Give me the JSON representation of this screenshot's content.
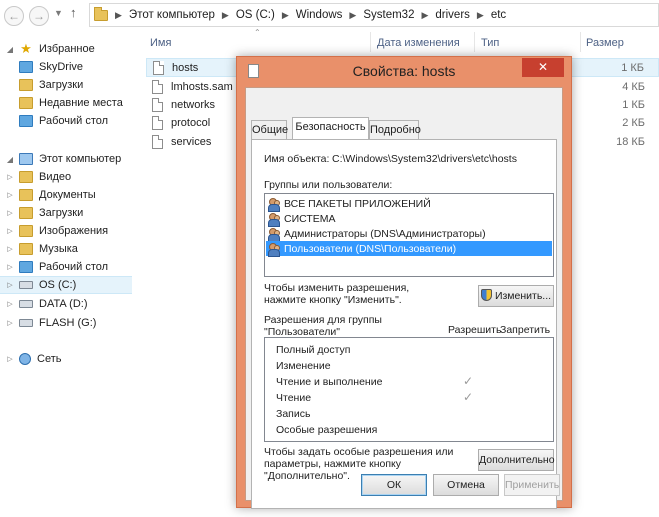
{
  "address": {
    "crumbs": [
      "Этот компьютер",
      "OS (C:)",
      "Windows",
      "System32",
      "drivers",
      "etc"
    ]
  },
  "nav": {
    "items": [
      {
        "label": "Избранное",
        "icon": "star-icon",
        "group": true
      },
      {
        "label": "SkyDrive",
        "icon": "folder-icon"
      },
      {
        "label": "Загрузки",
        "icon": "folder-icon"
      },
      {
        "label": "Недавние места",
        "icon": "folder-icon"
      },
      {
        "label": "Рабочий стол",
        "icon": "folder-icon"
      },
      {
        "label": "Этот компьютер",
        "icon": "computer-icon",
        "group": true
      },
      {
        "label": "Видео",
        "icon": "folder-icon"
      },
      {
        "label": "Документы",
        "icon": "folder-icon"
      },
      {
        "label": "Загрузки",
        "icon": "folder-icon"
      },
      {
        "label": "Изображения",
        "icon": "folder-icon"
      },
      {
        "label": "Музыка",
        "icon": "folder-icon"
      },
      {
        "label": "Рабочий стол",
        "icon": "folder-icon"
      },
      {
        "label": "OS (C:)",
        "icon": "drive-icon",
        "selected": true
      },
      {
        "label": "DATA (D:)",
        "icon": "drive-icon"
      },
      {
        "label": "FLASH (G:)",
        "icon": "drive-icon"
      },
      {
        "label": "Сеть",
        "icon": "network-icon",
        "group": true
      }
    ]
  },
  "columns": {
    "name": "Имя",
    "date": "Дата изменения",
    "type": "Тип",
    "size": "Размер"
  },
  "files": [
    {
      "name": "hosts",
      "size": "1 КБ",
      "selected": true
    },
    {
      "name": "lmhosts.sam",
      "size": "4 КБ"
    },
    {
      "name": "networks",
      "size": "1 КБ"
    },
    {
      "name": "protocol",
      "size": "2 КБ"
    },
    {
      "name": "services",
      "size": "18 КБ"
    }
  ],
  "dialog": {
    "title": "Свойства: hosts",
    "close_glyph": "✕",
    "tabs": [
      "Общие",
      "Безопасность",
      "Подробно"
    ],
    "active_tab": "Безопасность",
    "object_label": "Имя объекта:",
    "object_path": "C:\\Windows\\System32\\drivers\\etc\\hosts",
    "groups_label": "Группы или пользователи:",
    "groups": [
      {
        "name": "ВСЕ ПАКЕТЫ ПРИЛОЖЕНИЙ"
      },
      {
        "name": "СИСТЕМА"
      },
      {
        "name": "Администраторы (DNS\\Администраторы)"
      },
      {
        "name": "Пользователи (DNS\\Пользователи)",
        "selected": true
      }
    ],
    "change_hint_1": "Чтобы изменить разрешения,",
    "change_hint_2": "нажмите кнопку \"Изменить\".",
    "change_button": "Изменить...",
    "perm_for_1": "Разрешения для группы",
    "perm_for_2": "\"Пользователи\"",
    "allow_col": "Разрешить",
    "deny_col": "Запретить",
    "permissions": [
      {
        "name": "Полный доступ",
        "allow": false
      },
      {
        "name": "Изменение",
        "allow": false
      },
      {
        "name": "Чтение и выполнение",
        "allow": true
      },
      {
        "name": "Чтение",
        "allow": true
      },
      {
        "name": "Запись",
        "allow": false
      },
      {
        "name": "Особые разрешения",
        "allow": false
      }
    ],
    "check_glyph": "✓",
    "advanced_hint_1": "Чтобы задать особые разрешения или",
    "advanced_hint_2": "параметры, нажмите кнопку",
    "advanced_hint_3": "\"Дополнительно\".",
    "advanced_button": "Дополнительно",
    "ok": "ОК",
    "cancel": "Отмена",
    "apply": "Применить"
  }
}
